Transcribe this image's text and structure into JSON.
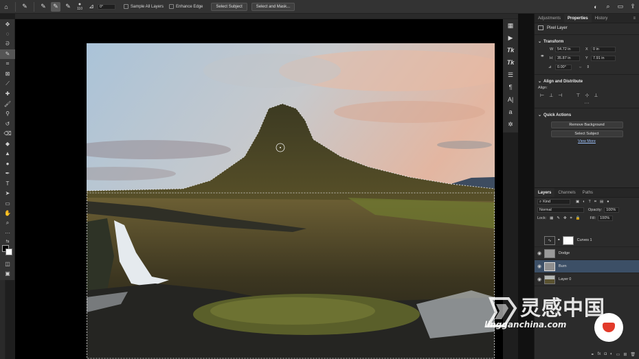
{
  "options_bar": {
    "brush_size": "110",
    "angle": "0°",
    "sample_all_layers": "Sample All Layers",
    "enhance_edge": "Enhance Edge",
    "select_subject": "Select Subject",
    "select_and_mask": "Select and Mask..."
  },
  "right_panel": {
    "tabs": [
      "Adjustments",
      "Properties",
      "History"
    ],
    "active_tab": "Properties",
    "pixel_layer": "Pixel Layer",
    "transform": {
      "title": "Transform",
      "w_label": "W",
      "w": "54.72 in",
      "x_label": "X",
      "x": "0 in",
      "h_label": "H",
      "h": "35.87 in",
      "y_label": "Y",
      "y": "7.91 in",
      "angle": "0.00°"
    },
    "align": {
      "title": "Align and Distribute",
      "align_label": "Align:"
    },
    "quick_actions": {
      "title": "Quick Actions",
      "remove_background": "Remove Background",
      "select_subject": "Select Subject",
      "view_more": "View More"
    }
  },
  "layers_panel": {
    "tabs": [
      "Layers",
      "Channels",
      "Paths"
    ],
    "kind": "Kind",
    "blend_mode": "Normal",
    "opacity_label": "Opacity:",
    "opacity": "100%",
    "lock_label": "Lock:",
    "fill_label": "Fill:",
    "fill": "100%",
    "layers": [
      {
        "name": "Curves 1",
        "visible": false,
        "selected": false
      },
      {
        "name": "Dodge",
        "visible": true,
        "selected": false
      },
      {
        "name": "Burn",
        "visible": true,
        "selected": true
      },
      {
        "name": "Layer 0",
        "visible": true,
        "selected": false
      }
    ]
  },
  "watermark": {
    "brand_cn": "灵感中国",
    "brand_url": "lingganchina.com"
  },
  "colors": {
    "selected_layer": "#3c4f66",
    "link": "#9fc4ff",
    "watermark_red": "#e23a2a"
  }
}
